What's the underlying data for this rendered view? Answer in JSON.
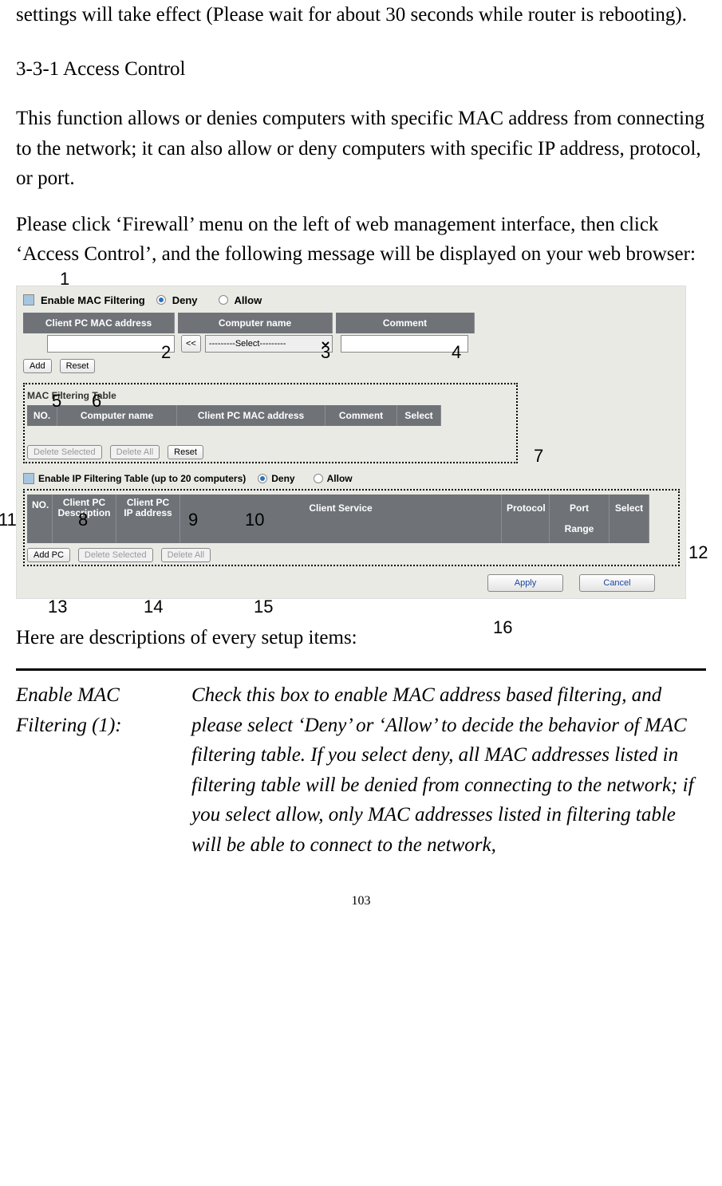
{
  "intro_tail": "settings will take effect (Please wait for about 30 seconds while router is rebooting).",
  "section_heading": "3-3-1 Access Control",
  "para1": "This function allows or denies computers with specific MAC address from connecting to the network; it can also allow or deny computers with specific IP address, protocol, or port.",
  "para2": "Please click ‘Firewall’ menu on the left of web management interface, then click ‘Access Control’, and the following message will be displayed on your web browser:",
  "screenshot": {
    "mac_filter": {
      "enable_label": "Enable MAC Filtering",
      "deny": "Deny",
      "allow": "Allow",
      "headers": {
        "mac": "Client PC MAC address",
        "name": "Computer name",
        "comment": "Comment"
      },
      "copy_btn": "<<",
      "select_placeholder": "---------Select---------",
      "add": "Add",
      "reset": "Reset"
    },
    "mac_table": {
      "title": "MAC Filtering Table",
      "headers": {
        "no": "NO.",
        "name": "Computer name",
        "mac": "Client PC MAC address",
        "comment": "Comment",
        "select": "Select"
      },
      "delete_selected": "Delete Selected",
      "delete_all": "Delete All",
      "reset": "Reset"
    },
    "ip_filter": {
      "enable_label": "Enable IP Filtering Table (up to 20 computers)",
      "deny": "Deny",
      "allow": "Allow",
      "headers": {
        "no": "NO.",
        "desc": "Client PC Description",
        "ip": "Client PC IP address",
        "service": "Client Service",
        "protocol": "Protocol",
        "port": "Port Range",
        "select": "Select"
      },
      "add_pc": "Add PC",
      "delete_selected": "Delete Selected",
      "delete_all": "Delete All"
    },
    "apply": "Apply",
    "cancel": "Cancel"
  },
  "callouts": {
    "c1": "1",
    "c2": "2",
    "c3": "3",
    "c4": "4",
    "c5": "5",
    "c6": "6",
    "c7": "7",
    "c8": "8",
    "c9": "9",
    "c10": "10",
    "c11": "11",
    "c12": "12",
    "c13": "13",
    "c14": "14",
    "c15": "15",
    "c16": "16"
  },
  "desc_intro": "Here are descriptions of every setup items:",
  "desc_table": {
    "term": "Enable MAC Filtering (1):",
    "body": "Check this box to enable MAC address based filtering, and please select ‘Deny’ or ‘Allow’ to decide the behavior of MAC filtering table. If you select deny, all MAC addresses listed in filtering table will be denied from connecting to the network; if you select allow, only MAC addresses listed in filtering table will be able to connect to the network,"
  },
  "page_number": "103"
}
